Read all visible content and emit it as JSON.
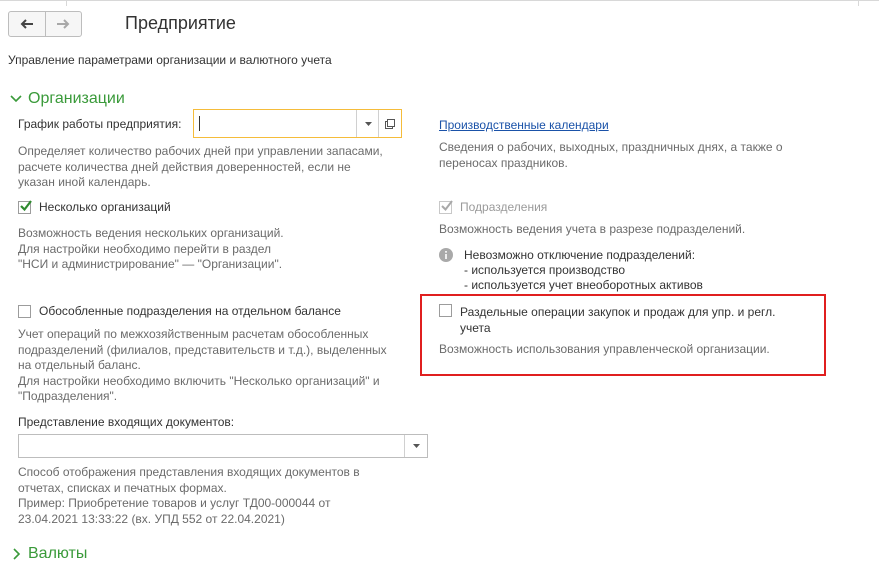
{
  "header": {
    "back_icon": "arrow-left-icon",
    "forward_icon": "arrow-right-icon",
    "title": "Предприятие",
    "subtitle": "Управление параметрами организации и валютного учета"
  },
  "organizations": {
    "section_label": "Организации",
    "expanded": true,
    "work_schedule": {
      "label": "График работы предприятия:",
      "value": "",
      "hint": [
        "Определяет количество рабочих дней при управлении запасами,",
        "расчете количества дней действия доверенностей, если не",
        "указан иной календарь."
      ]
    },
    "calendars": {
      "link": "Производственные календари",
      "hint": [
        "Сведения о рабочих, выходных, праздничных днях, а также о",
        "переносах праздников."
      ]
    },
    "multiple_orgs": {
      "label": "Несколько организаций",
      "checked": true,
      "hint": [
        "Возможность ведения нескольких организаций.",
        "Для настройки необходимо перейти в раздел",
        "\"НСИ и администрирование\" — \"Организации\"."
      ]
    },
    "subdivisions": {
      "label": "Подразделения",
      "checked": true,
      "disabled": true,
      "hint": "Возможность ведения учета в разрезе подразделений.",
      "info_title": "Невозможно отключение подразделений:",
      "info_items": [
        "- используется производство",
        "- используется учет внеоборотных активов"
      ]
    },
    "separate_balance": {
      "label": "Обособленные подразделения на отдельном балансе",
      "checked": false,
      "hint": [
        "Учет операций по межхозяйственным расчетам обособленных",
        "подразделений (филиалов, представительств и т.д.), выделенных",
        "на отдельный баланс.",
        "Для настройки необходимо включить \"Несколько организаций\" и",
        "\"Подразделения\"."
      ]
    },
    "separate_ops": {
      "label": [
        "Раздельные операции закупок и продаж для упр. и регл.",
        "учета"
      ],
      "checked": false,
      "hint": "Возможность использования управленческой организации."
    },
    "incoming_docs": {
      "label": "Представление входящих документов:",
      "value": "",
      "hint": [
        "Способ отображения представления входящих документов в",
        "отчетах, списках и печатных формах.",
        "Пример: Приобретение товаров и услуг ТД00-000044 от",
        "23.04.2021 13:33:22 (вх. УПД 552 от 22.04.2021)"
      ]
    }
  },
  "currencies": {
    "section_label": "Валюты",
    "expanded": false
  },
  "colors": {
    "accent_green": "#3a9a3a",
    "link_blue": "#1a52a8",
    "focus_yellow": "#f5bc3a",
    "highlight_red": "#e01f1f"
  }
}
